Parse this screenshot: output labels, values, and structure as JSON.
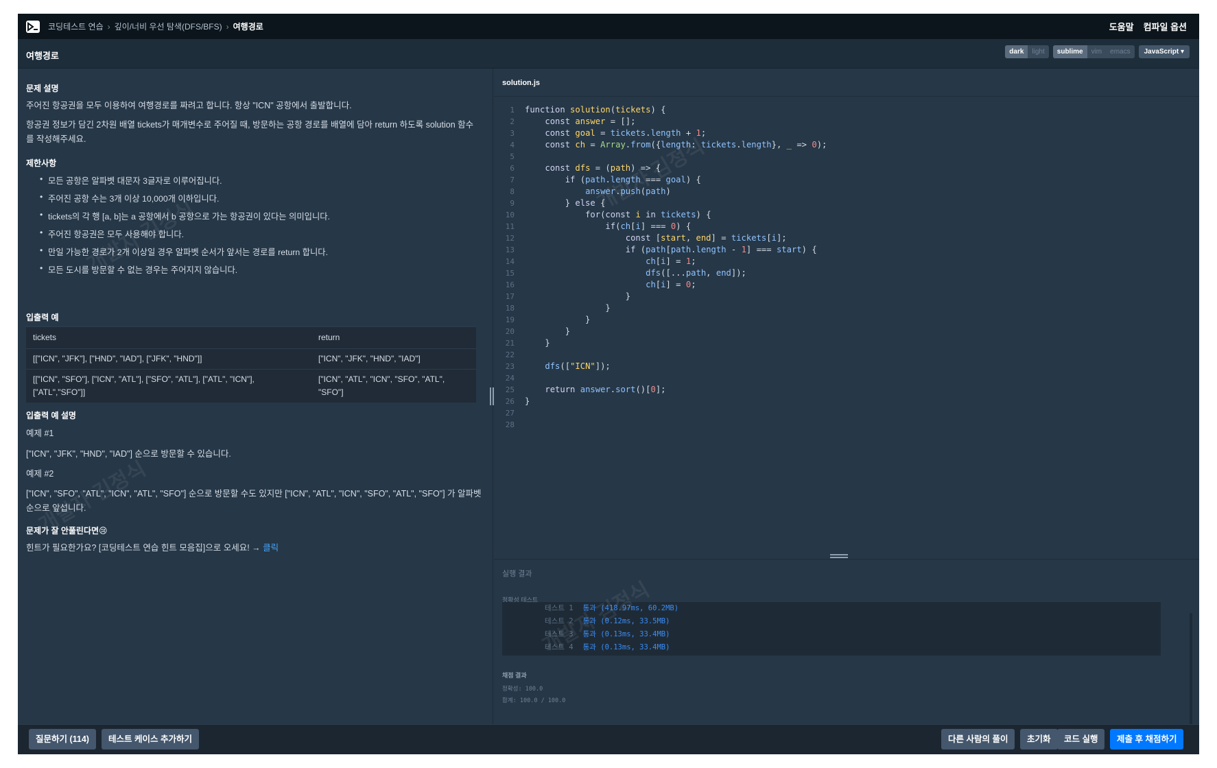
{
  "breadcrumb": [
    "코딩테스트 연습",
    "깊이/너비 우선 탐색(DFS/BFS)",
    "여행경로"
  ],
  "topnav": {
    "help": "도움말",
    "compile_options": "컴파일 옵션"
  },
  "header": {
    "title": "여행경로"
  },
  "editor_options": {
    "themes": [
      "dark",
      "light"
    ],
    "keymaps": [
      "sublime",
      "vim",
      "emacs"
    ],
    "language": "JavaScript"
  },
  "problem": {
    "desc_heading": "문제 설명",
    "desc_p1": "주어진 항공권을 모두 이용하여 여행경로를 짜려고 합니다. 항상 \"ICN\" 공항에서 출발합니다.",
    "desc_p2a": "항공권 정보가 담긴 2차원 배열 tickets가 매개변수로 주어질 때, 방문하는 공항 경로를 배열에 담아 return 하도록 solution 함수",
    "desc_p2b": "를 작성해주세요.",
    "constraints_heading": "제한사항",
    "constraints": [
      "모든 공항은 알파벳 대문자 3글자로 이루어집니다.",
      "주어진 공항 수는 3개 이상 10,000개 이하입니다.",
      "tickets의 각 행 [a, b]는 a 공항에서 b 공항으로 가는 항공권이 있다는 의미입니다.",
      "주어진 항공권은 모두 사용해야 합니다.",
      "만일 가능한 경로가 2개 이상일 경우 알파벳 순서가 앞서는 경로를 return 합니다.",
      "모든 도시를 방문할 수 없는 경우는 주어지지 않습니다."
    ],
    "io_heading": "입출력 예",
    "io_table": {
      "headers": [
        "tickets",
        "return"
      ],
      "rows": [
        [
          "[[\"ICN\", \"JFK\"], [\"HND\", \"IAD\"], [\"JFK\", \"HND\"]]",
          "[\"ICN\", \"JFK\", \"HND\", \"IAD\"]"
        ],
        [
          "[[\"ICN\", \"SFO\"], [\"ICN\", \"ATL\"], [\"SFO\", \"ATL\"], [\"ATL\", \"ICN\"], [\"ATL\",\"SFO\"]]",
          "[\"ICN\", \"ATL\", \"ICN\", \"SFO\", \"ATL\", \"SFO\"]"
        ]
      ]
    },
    "io_desc_heading": "입출력 예 설명",
    "ex1_title": "예제 #1",
    "ex1_text": "[\"ICN\", \"JFK\", \"HND\", \"IAD\"] 순으로 방문할 수 있습니다.",
    "ex2_title": "예제 #2",
    "ex2_text_a": "[\"ICN\", \"SFO\", \"ATL\", \"ICN\", \"ATL\", \"SFO\"] 순으로 방문할 수도 있지만 [\"ICN\", \"ATL\", \"ICN\", \"SFO\", \"ATL\", \"SFO\"] 가 알파벳",
    "ex2_text_b": "순으로 앞섭니다.",
    "hint_heading": "문제가 잘 안풀린다면😢",
    "hint_text": "힌트가 필요한가요? [코딩테스트 연습 힌트 모음집]으로 오세요! → ",
    "hint_link": "클릭"
  },
  "editor": {
    "filename": "solution.js"
  },
  "result": {
    "label": "실행 결과",
    "tabs": "정확성  테스트",
    "tests": [
      {
        "name": "테스트 1",
        "result": "통과 (418.97ms, 60.2MB)"
      },
      {
        "name": "테스트 2",
        "result": "통과 (0.12ms, 33.5MB)"
      },
      {
        "name": "테스트 3",
        "result": "통과 (0.13ms, 33.4MB)"
      },
      {
        "name": "테스트 4",
        "result": "통과 (0.13ms, 33.4MB)"
      }
    ],
    "score_heading": "채점 결과",
    "accuracy": "정확성: 100.0",
    "total": "합계: 100.0 / 100.0"
  },
  "bottom": {
    "ask": "질문하기 (114)",
    "add_testcase": "테스트 케이스 추가하기",
    "others": "다른 사람의 풀이",
    "reset": "초기화",
    "run": "코드 실행",
    "submit": "제출 후 채점하기"
  },
  "watermark": "개발자 김정식"
}
